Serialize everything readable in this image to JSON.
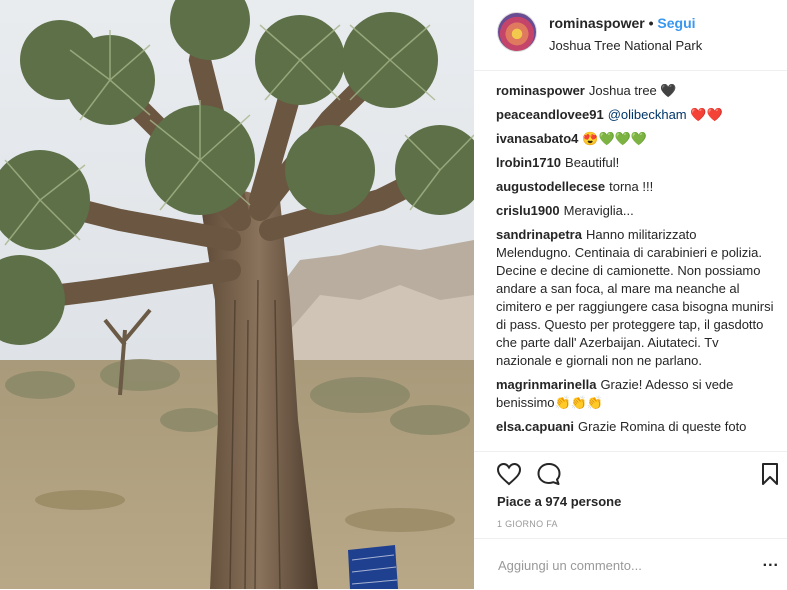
{
  "header": {
    "username": "rominaspower",
    "separator": "•",
    "follow_label": "Segui",
    "location": "Joshua Tree National Park"
  },
  "comments": [
    {
      "user": "rominaspower",
      "text": "Joshua tree 🖤"
    },
    {
      "user": "peaceandlovee91",
      "mention": "@olibeckham",
      "text": " ❤️❤️"
    },
    {
      "user": "ivanasabato4",
      "text": "😍💚💚💚"
    },
    {
      "user": "lrobin1710",
      "text": "Beautiful!"
    },
    {
      "user": "augustodellecese",
      "text": "torna !!!"
    },
    {
      "user": "crislu1900",
      "text": "Meraviglia..."
    },
    {
      "user": "sandrinapetra",
      "text": "Hanno militarizzato Melendugno. Centinaia di carabinieri e polizia. Decine e decine di camionette. Non possiamo andare a san foca, al mare ma neanche al cimitero e per raggiungere casa bisogna munirsi di pass. Questo per proteggere tap, il gasdotto che parte dall' Azerbaijan. Aiutateci. Tv nazionale e giornali non ne parlano."
    },
    {
      "user": "magrinmarinella",
      "text": "Grazie! Adesso si vede benissimo👏👏👏"
    },
    {
      "user": "elsa.capuani",
      "text": "Grazie Romina di queste foto"
    }
  ],
  "actions": {
    "like_icon": "heart-icon",
    "comment_icon": "comment-icon",
    "save_icon": "bookmark-icon"
  },
  "likes_text": "Piace a 974 persone",
  "time_ago": "1 giorno fa",
  "add_comment": {
    "placeholder": "Aggiungi un commento...",
    "more_label": "..."
  },
  "colors": {
    "follow": "#3897f0",
    "text": "#262626",
    "muted": "#999999",
    "border": "#efefef"
  }
}
